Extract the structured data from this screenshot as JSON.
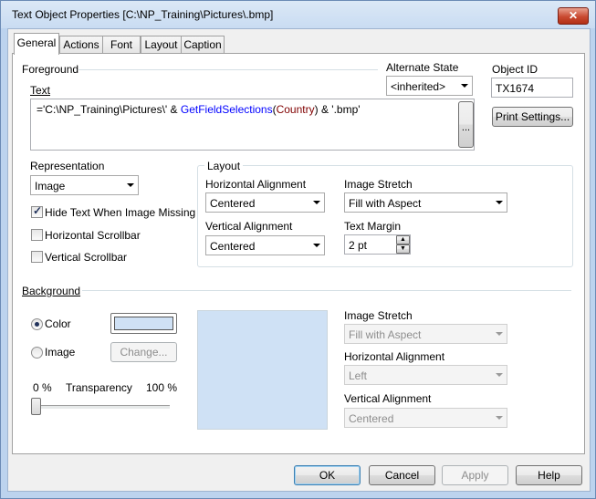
{
  "window": {
    "title": "Text Object Properties [C:\\NP_Training\\Pictures\\.bmp]",
    "close_glyph": "✕"
  },
  "tabs": [
    {
      "label": "General"
    },
    {
      "label": "Actions"
    },
    {
      "label": "Font"
    },
    {
      "label": "Layout"
    },
    {
      "label": "Caption"
    }
  ],
  "foreground": {
    "label": "Foreground",
    "text_label": "Text",
    "expression": {
      "part1": "='C:\\NP_Training\\Pictures\\' & ",
      "func": "GetFieldSelections",
      "paren_open": "(",
      "field": "Country",
      "paren_close": ")",
      "part2": " & '.bmp'"
    },
    "ellipsis_label": "..."
  },
  "alternate_state": {
    "label": "Alternate State",
    "value": "<inherited>"
  },
  "object_id": {
    "label": "Object ID",
    "value": "TX1674"
  },
  "print_settings_label": "Print Settings...",
  "representation": {
    "label": "Representation",
    "value": "Image"
  },
  "checkboxes": [
    {
      "label": "Hide Text When Image Missing",
      "checked": true
    },
    {
      "label": "Horizontal Scrollbar",
      "checked": false
    },
    {
      "label": "Vertical Scrollbar",
      "checked": false
    }
  ],
  "layout": {
    "label": "Layout",
    "horizontal_alignment": {
      "label": "Horizontal Alignment",
      "value": "Centered"
    },
    "vertical_alignment": {
      "label": "Vertical Alignment",
      "value": "Centered"
    },
    "image_stretch": {
      "label": "Image Stretch",
      "value": "Fill with Aspect"
    },
    "text_margin": {
      "label": "Text Margin",
      "value": "2 pt"
    }
  },
  "background": {
    "label": "Background",
    "color_option": "Color",
    "image_option": "Image",
    "change_label": "Change...",
    "color_swatch": "#cfe1f5",
    "transparency": {
      "label": "Transparency",
      "min_label": "0 %",
      "max_label": "100 %",
      "value": 0
    },
    "image_stretch": {
      "label": "Image Stretch",
      "value": "Fill with Aspect"
    },
    "horizontal_alignment": {
      "label": "Horizontal Alignment",
      "value": "Left"
    },
    "vertical_alignment": {
      "label": "Vertical Alignment",
      "value": "Centered"
    }
  },
  "footer": {
    "ok": "OK",
    "cancel": "Cancel",
    "apply": "Apply",
    "help": "Help"
  },
  "colors": {
    "function_blue": "#0000ff",
    "field_maroon": "#800000"
  }
}
